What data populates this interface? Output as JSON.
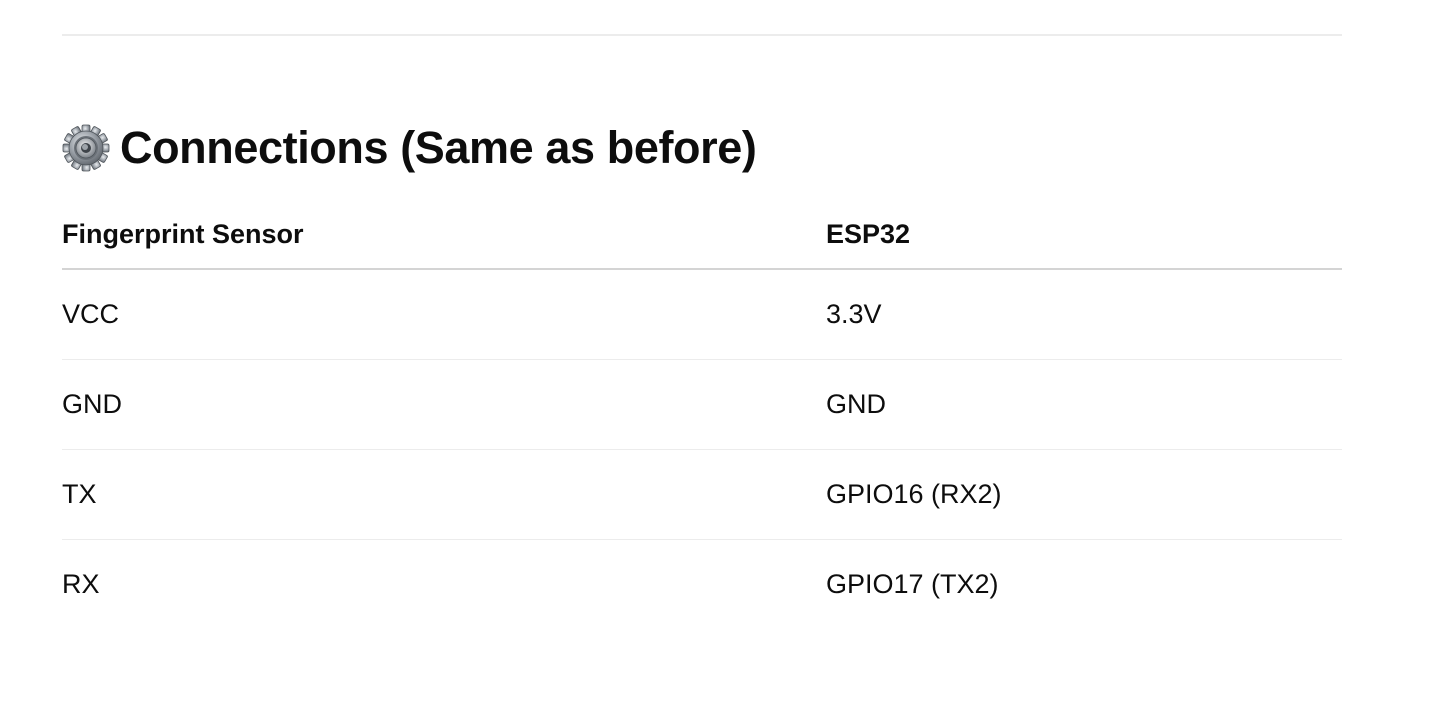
{
  "section": {
    "icon": "gear-icon",
    "title": "Connections (Same as before)"
  },
  "table": {
    "headers": [
      "Fingerprint Sensor",
      "ESP32"
    ],
    "rows": [
      [
        "VCC",
        "3.3V"
      ],
      [
        "GND",
        "GND"
      ],
      [
        "TX",
        "GPIO16 (RX2)"
      ],
      [
        "RX",
        "GPIO17 (TX2)"
      ]
    ]
  },
  "colors": {
    "text": "#0d0d0d",
    "divider": "#ececec",
    "header_rule": "#d4d4d4",
    "gear_metal": "#8a8f96"
  }
}
